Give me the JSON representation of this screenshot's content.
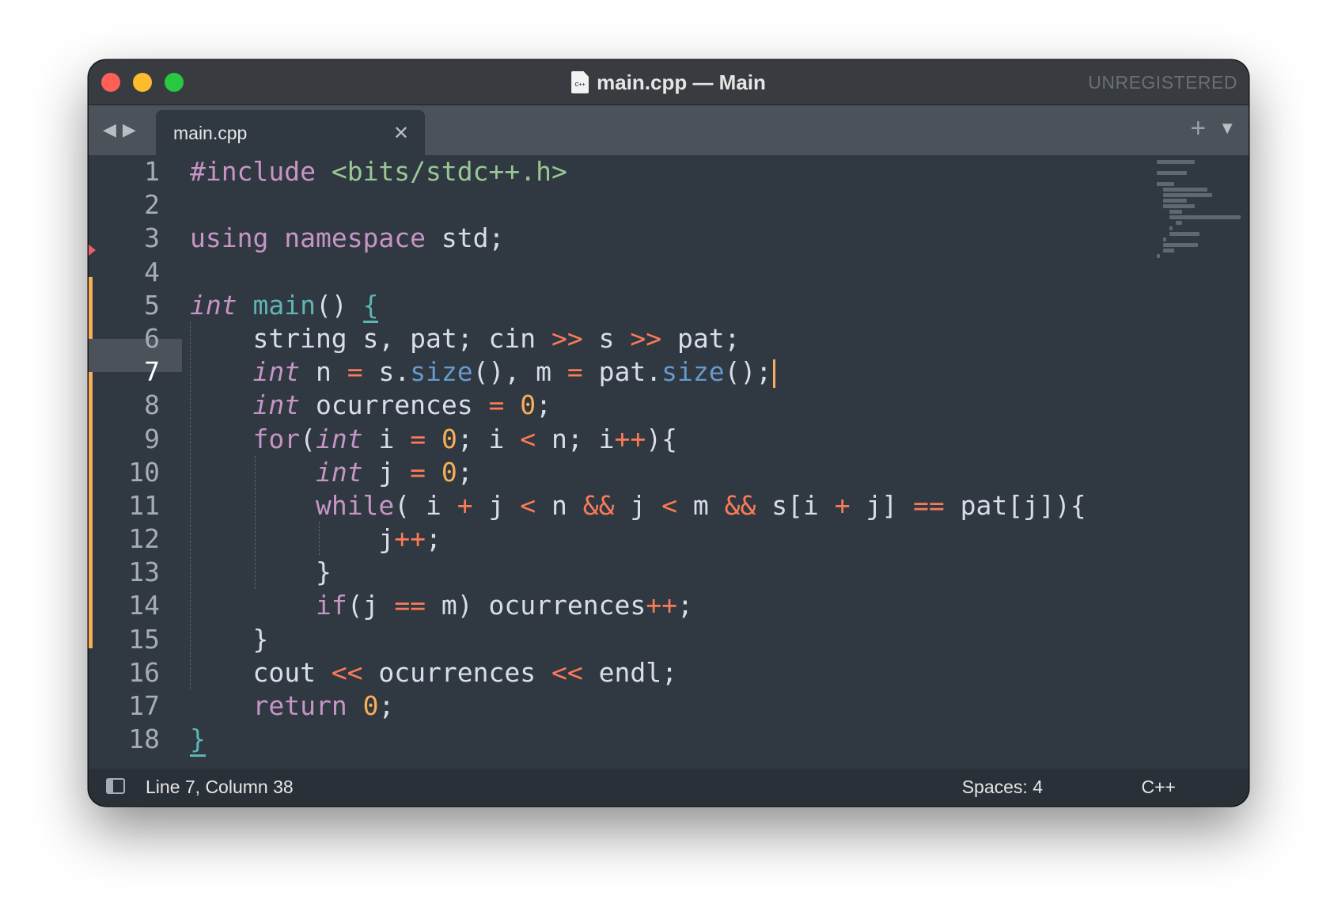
{
  "window": {
    "title": "main.cpp — Main",
    "file_icon_text": "C++",
    "unregistered": "UNREGISTERED"
  },
  "tabs": [
    {
      "label": "main.cpp",
      "active": true
    }
  ],
  "tab_actions": {
    "new_tab": "+",
    "menu": "▼"
  },
  "nav": {
    "back": "◀",
    "forward": "▶"
  },
  "editor": {
    "current_line": 7,
    "lines": [
      [
        [
          "k",
          "#include"
        ],
        [
          "t",
          " "
        ],
        [
          "g",
          "<bits/stdc++.h>"
        ]
      ],
      [],
      [
        [
          "k",
          "using"
        ],
        [
          "t",
          " "
        ],
        [
          "k",
          "namespace"
        ],
        [
          "t",
          " std;"
        ]
      ],
      [],
      [
        [
          "i",
          "int"
        ],
        [
          "t",
          " "
        ],
        [
          "f",
          "main"
        ],
        [
          "t",
          "() "
        ],
        [
          "u",
          "{"
        ]
      ],
      [
        [
          "t",
          "    string s, pat; cin "
        ],
        [
          "o",
          ">>"
        ],
        [
          "t",
          " s "
        ],
        [
          "o",
          ">>"
        ],
        [
          "t",
          " pat;"
        ]
      ],
      [
        [
          "t",
          "    "
        ],
        [
          "i",
          "int"
        ],
        [
          "t",
          " n "
        ],
        [
          "o",
          "="
        ],
        [
          "t",
          " s."
        ],
        [
          "m",
          "size"
        ],
        [
          "t",
          "(), m "
        ],
        [
          "o",
          "="
        ],
        [
          "t",
          " pat."
        ],
        [
          "m",
          "size"
        ],
        [
          "t",
          "();"
        ],
        [
          "c",
          ""
        ]
      ],
      [
        [
          "t",
          "    "
        ],
        [
          "i",
          "int"
        ],
        [
          "t",
          " ocurrences "
        ],
        [
          "o",
          "="
        ],
        [
          "t",
          " "
        ],
        [
          "n",
          "0"
        ],
        [
          "t",
          ";"
        ]
      ],
      [
        [
          "t",
          "    "
        ],
        [
          "k",
          "for"
        ],
        [
          "t",
          "("
        ],
        [
          "i",
          "int"
        ],
        [
          "t",
          " i "
        ],
        [
          "o",
          "="
        ],
        [
          "t",
          " "
        ],
        [
          "n",
          "0"
        ],
        [
          "t",
          "; i "
        ],
        [
          "o",
          "<"
        ],
        [
          "t",
          " n; i"
        ],
        [
          "o",
          "++"
        ],
        [
          "t",
          "){"
        ]
      ],
      [
        [
          "t",
          "        "
        ],
        [
          "i",
          "int"
        ],
        [
          "t",
          " j "
        ],
        [
          "o",
          "="
        ],
        [
          "t",
          " "
        ],
        [
          "n",
          "0"
        ],
        [
          "t",
          ";"
        ]
      ],
      [
        [
          "t",
          "        "
        ],
        [
          "k",
          "while"
        ],
        [
          "t",
          "( i "
        ],
        [
          "o",
          "+"
        ],
        [
          "t",
          " j "
        ],
        [
          "o",
          "<"
        ],
        [
          "t",
          " n "
        ],
        [
          "o",
          "&&"
        ],
        [
          "t",
          " j "
        ],
        [
          "o",
          "<"
        ],
        [
          "t",
          " m "
        ],
        [
          "o",
          "&&"
        ],
        [
          "t",
          " s[i "
        ],
        [
          "o",
          "+"
        ],
        [
          "t",
          " j] "
        ],
        [
          "o",
          "=="
        ],
        [
          "t",
          " pat[j]){"
        ]
      ],
      [
        [
          "t",
          "            j"
        ],
        [
          "o",
          "++"
        ],
        [
          "t",
          ";"
        ]
      ],
      [
        [
          "t",
          "        }"
        ]
      ],
      [
        [
          "t",
          "        "
        ],
        [
          "k",
          "if"
        ],
        [
          "t",
          "(j "
        ],
        [
          "o",
          "=="
        ],
        [
          "t",
          " m) ocurrences"
        ],
        [
          "o",
          "++"
        ],
        [
          "t",
          ";"
        ]
      ],
      [
        [
          "t",
          "    }"
        ]
      ],
      [
        [
          "t",
          "    cout "
        ],
        [
          "o",
          "<<"
        ],
        [
          "t",
          " ocurrences "
        ],
        [
          "o",
          "<<"
        ],
        [
          "t",
          " endl;"
        ]
      ],
      [
        [
          "t",
          "    "
        ],
        [
          "k",
          "return"
        ],
        [
          "t",
          " "
        ],
        [
          "n",
          "0"
        ],
        [
          "t",
          ";"
        ]
      ],
      [
        [
          "u",
          "}"
        ]
      ]
    ]
  },
  "status": {
    "position": "Line 7, Column 38",
    "indentation": "Spaces: 4",
    "syntax": "C++"
  },
  "colors": {
    "background": "#303841",
    "keyword": "#c695c6",
    "function": "#5fb4b4",
    "method": "#6699cc",
    "operator": "#f97b58",
    "number": "#f9ae58",
    "string": "#99c794",
    "modified_marker": "#f9ae58",
    "deleted_marker": "#ec5f67"
  }
}
